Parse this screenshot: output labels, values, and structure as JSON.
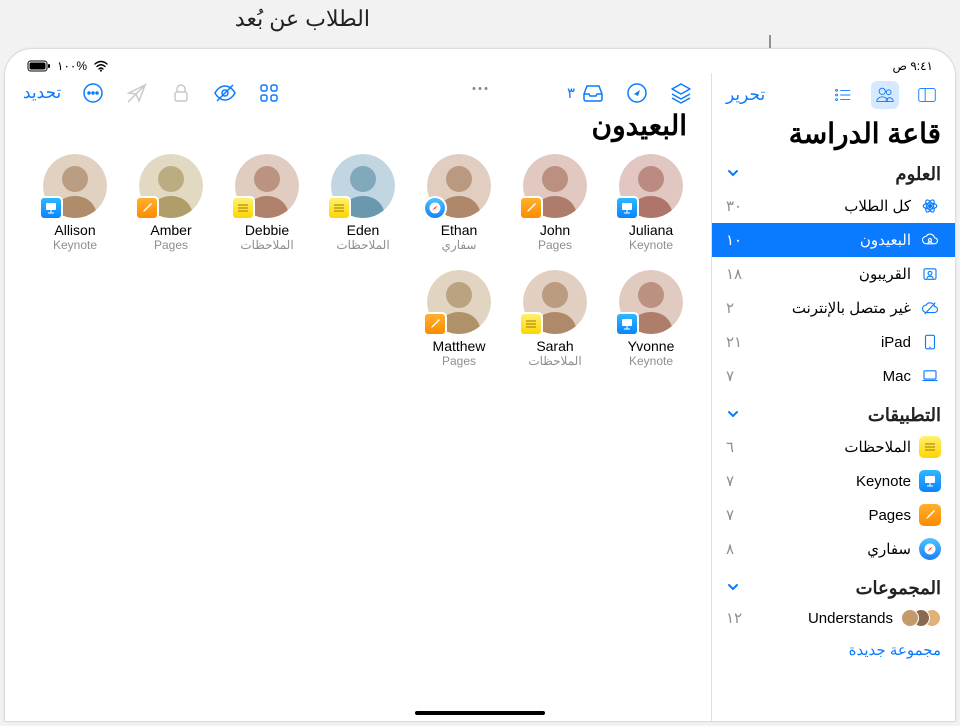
{
  "callout": "الطلاب عن بُعد",
  "status": {
    "time": "٩:٤١ ص",
    "battery": "%١٠٠"
  },
  "wifi_icon": "wifi",
  "sidebar": {
    "edit": "تحرير",
    "title": "قاعة الدراسة",
    "sections": {
      "sciences": {
        "header": "العلوم"
      },
      "apps": {
        "header": "التطبيقات"
      },
      "groups": {
        "header": "المجموعات"
      }
    },
    "filters": [
      {
        "id": "all",
        "label": "كل الطلاب",
        "count": "٣٠",
        "icon": "atom"
      },
      {
        "id": "remote",
        "label": "البعيدون",
        "count": "١٠",
        "icon": "cloud-person",
        "selected": true
      },
      {
        "id": "nearby",
        "label": "القريبون",
        "count": "١٨",
        "icon": "person-rect"
      },
      {
        "id": "offline",
        "label": "غير متصل بالإنترنت",
        "count": "٢",
        "icon": "cloud-slash"
      },
      {
        "id": "ipad",
        "label": "iPad",
        "count": "٢١",
        "icon": "ipad"
      },
      {
        "id": "mac",
        "label": "Mac",
        "count": "٧",
        "icon": "mac"
      }
    ],
    "apps": [
      {
        "label": "الملاحظات",
        "count": "٦",
        "app": "notes"
      },
      {
        "label": "Keynote",
        "count": "٧",
        "app": "keynote"
      },
      {
        "label": "Pages",
        "count": "٧",
        "app": "pages"
      },
      {
        "label": "سفاري",
        "count": "٨",
        "app": "safari"
      }
    ],
    "groups": [
      {
        "label": "Understands",
        "count": "١٢"
      }
    ],
    "new_group": "مجموعة جديدة"
  },
  "main": {
    "title": "البعيدون",
    "select": "تحديد",
    "inbox_count": "٣",
    "students": [
      {
        "name": "Allison",
        "app_label": "Keynote",
        "app": "keynote",
        "hue": 30
      },
      {
        "name": "Amber",
        "app_label": "Pages",
        "app": "pages",
        "hue": 45
      },
      {
        "name": "Debbie",
        "app_label": "الملاحظات",
        "app": "notes",
        "hue": 20
      },
      {
        "name": "Eden",
        "app_label": "الملاحظات",
        "app": "notes",
        "hue": 200
      },
      {
        "name": "Ethan",
        "app_label": "سفاري",
        "app": "safari",
        "hue": 25
      },
      {
        "name": "John",
        "app_label": "Pages",
        "app": "pages",
        "hue": 15
      },
      {
        "name": "Juliana",
        "app_label": "Keynote",
        "app": "keynote",
        "hue": 10
      },
      {
        "name": "Matthew",
        "app_label": "Pages",
        "app": "pages",
        "hue": 35
      },
      {
        "name": "Sarah",
        "app_label": "الملاحظات",
        "app": "notes",
        "hue": 28
      },
      {
        "name": "Yvonne",
        "app_label": "Keynote",
        "app": "keynote",
        "hue": 18
      }
    ]
  }
}
